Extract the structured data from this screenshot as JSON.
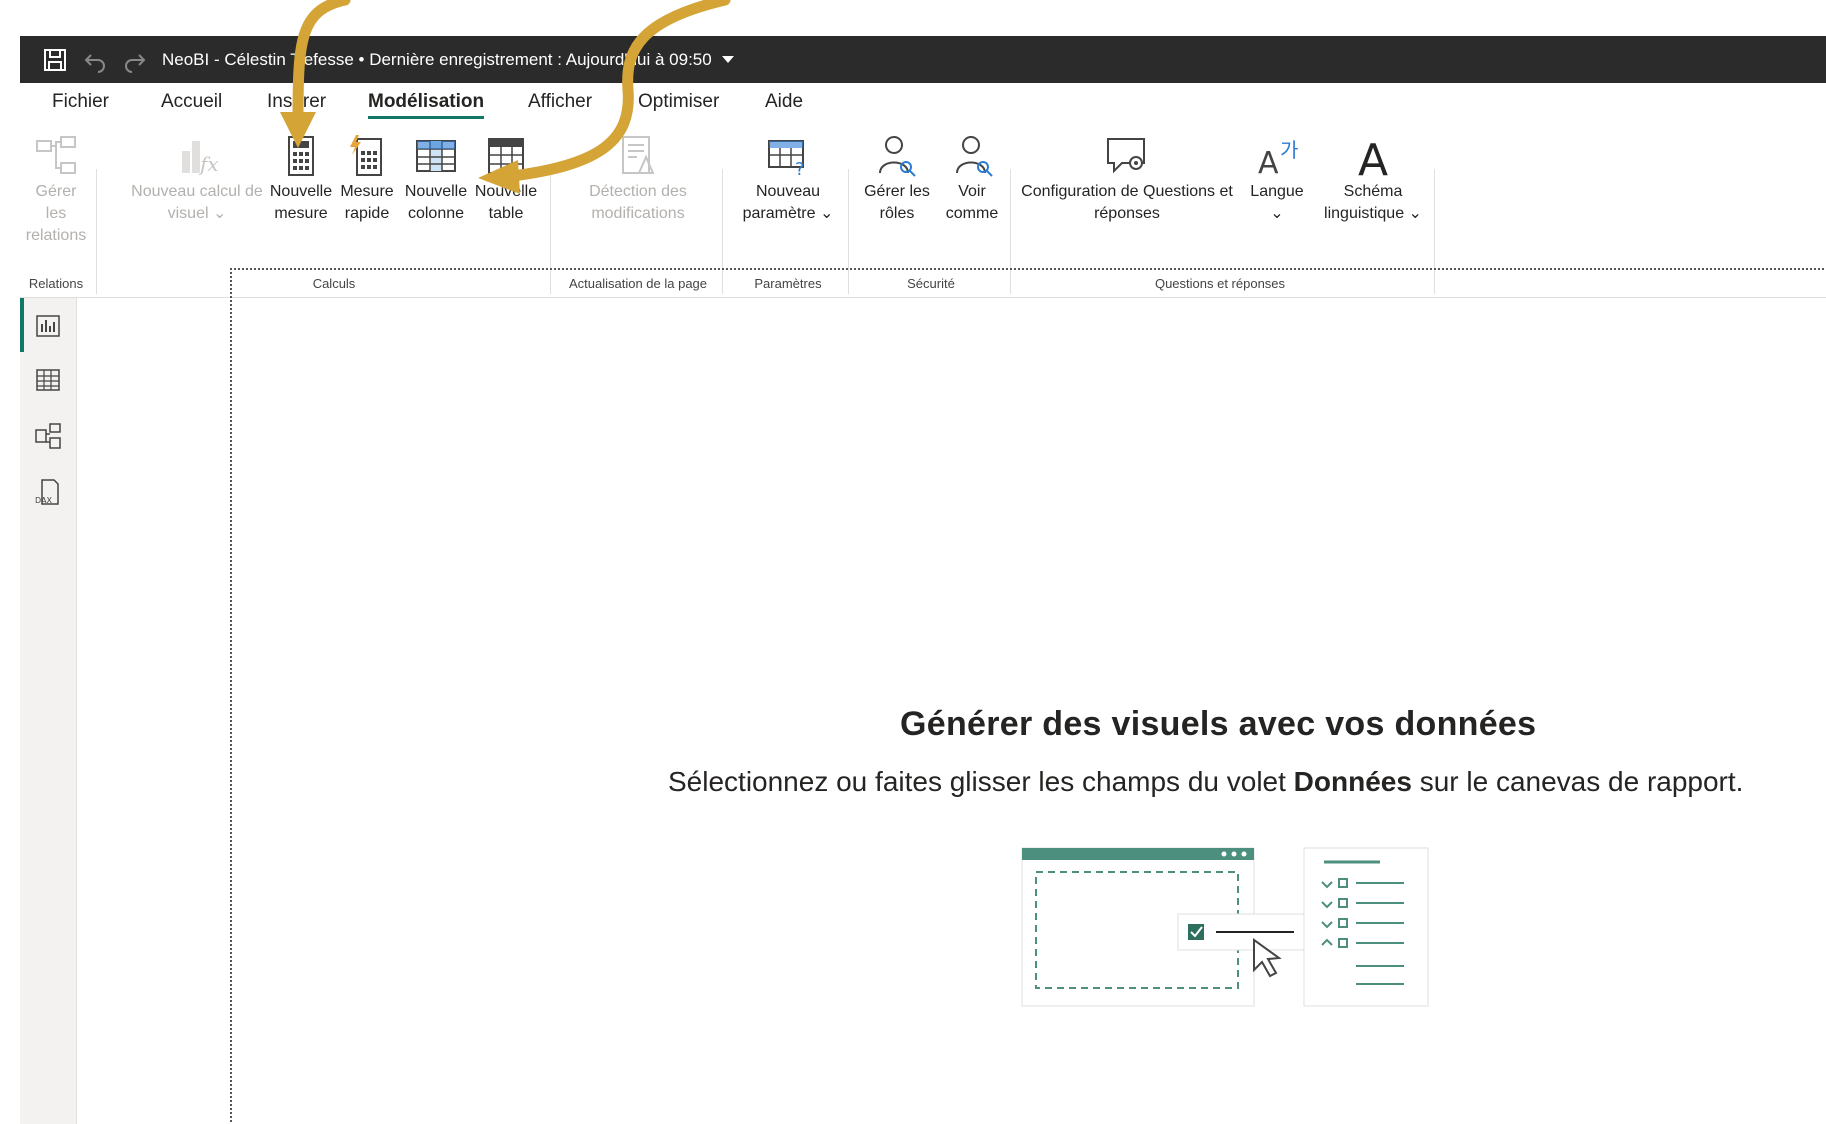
{
  "window": {
    "title": "NeoBI - Célestin Tiefesse • Dernière enregistrement : Aujourd'hui à 09:50"
  },
  "menu": {
    "items": [
      "Fichier",
      "Accueil",
      "Insérer",
      "Modélisation",
      "Afficher",
      "Optimiser",
      "Aide"
    ],
    "active": "Modélisation"
  },
  "ribbon": {
    "groups": [
      {
        "label": "Relations"
      },
      {
        "label": "Calculs"
      },
      {
        "label": "Actualisation de la page"
      },
      {
        "label": "Paramètres"
      },
      {
        "label": "Sécurité"
      },
      {
        "label": "Questions et réponses"
      }
    ],
    "buttons": {
      "gerer_relations": {
        "line1": "Gérer les",
        "line2": "relations",
        "disabled": true
      },
      "nouveau_calcul": {
        "line1": "Nouveau calcul de",
        "line2": "visuel ⌄",
        "disabled": true
      },
      "nouvelle_mesure": {
        "line1": "Nouvelle",
        "line2": "mesure"
      },
      "mesure_rapide": {
        "line1": "Mesure",
        "line2": "rapide"
      },
      "nouvelle_colonne": {
        "line1": "Nouvelle",
        "line2": "colonne"
      },
      "nouvelle_table": {
        "line1": "Nouvelle",
        "line2": "table"
      },
      "detection": {
        "line1": "Détection des",
        "line2": "modifications",
        "disabled": true
      },
      "nouveau_parametre": {
        "line1": "Nouveau",
        "line2": "paramètre ⌄"
      },
      "gerer_roles": {
        "line1": "Gérer les",
        "line2": "rôles"
      },
      "voir_comme": {
        "line1": "Voir",
        "line2": "comme"
      },
      "config_qr": {
        "line1": "Configuration de Questions et",
        "line2": "réponses"
      },
      "langue": {
        "line1": "Langue",
        "line2": "⌄"
      },
      "schema": {
        "line1": "Schéma",
        "line2": "linguistique ⌄"
      }
    }
  },
  "canvas": {
    "empty_title": "Générer des visuels avec vos données",
    "empty_sub_before": "Sélectionnez ou faites glisser les champs du volet ",
    "empty_sub_bold": "Données",
    "empty_sub_after": " sur le canevas de rapport."
  },
  "colors": {
    "accent": "#117865",
    "arrow": "#d4a437",
    "titlebar": "#2b2b2b"
  }
}
